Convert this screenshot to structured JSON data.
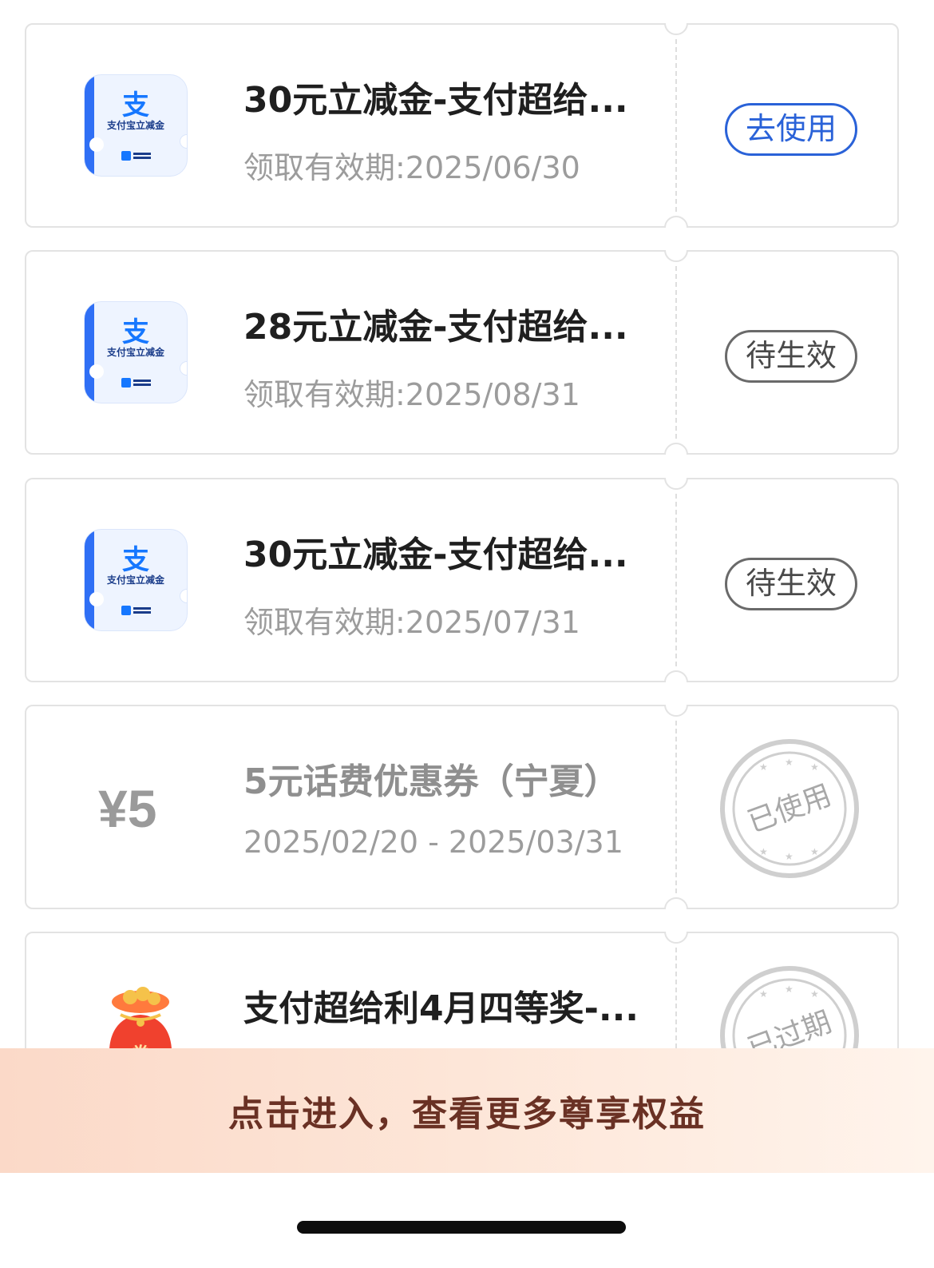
{
  "coupons": [
    {
      "kind": "alipay",
      "icon_name": "alipay-discount-card-icon",
      "icon_char": "支",
      "icon_label": "支付宝立减金",
      "title": "30元立减金-支付超给...",
      "subtitle": "领取有效期:2025/06/30",
      "action": {
        "type": "button",
        "label": "去使用",
        "color": "#2a62d8"
      }
    },
    {
      "kind": "alipay",
      "icon_name": "alipay-discount-card-icon",
      "icon_char": "支",
      "icon_label": "支付宝立减金",
      "title": "28元立减金-支付超给...",
      "subtitle": "领取有效期:2025/08/31",
      "action": {
        "type": "pill",
        "label": "待生效",
        "color": "#6a6a6a"
      }
    },
    {
      "kind": "alipay",
      "icon_name": "alipay-discount-card-icon",
      "icon_char": "支",
      "icon_label": "支付宝立减金",
      "title": "30元立减金-支付超给...",
      "subtitle": "领取有效期:2025/07/31",
      "action": {
        "type": "pill",
        "label": "待生效",
        "color": "#6a6a6a"
      }
    },
    {
      "kind": "yen",
      "amount": "¥5",
      "title": "5元话费优惠券（宁夏）",
      "subtitle": "2025/02/20 - 2025/03/31",
      "action": {
        "type": "stamp",
        "label": "已使用",
        "icon_name": "used-stamp-icon"
      }
    },
    {
      "kind": "redbag",
      "icon_name": "red-lucky-bag-icon",
      "title": "支付超给利4月四等奖-...",
      "subtitle": "",
      "action": {
        "type": "stamp",
        "label": "已过期",
        "icon_name": "expired-stamp-icon"
      }
    }
  ],
  "banner": {
    "label": "点击进入，查看更多尊享权益"
  },
  "colors": {
    "accent_blue": "#2a62d8",
    "banner_text": "#6a3124"
  }
}
